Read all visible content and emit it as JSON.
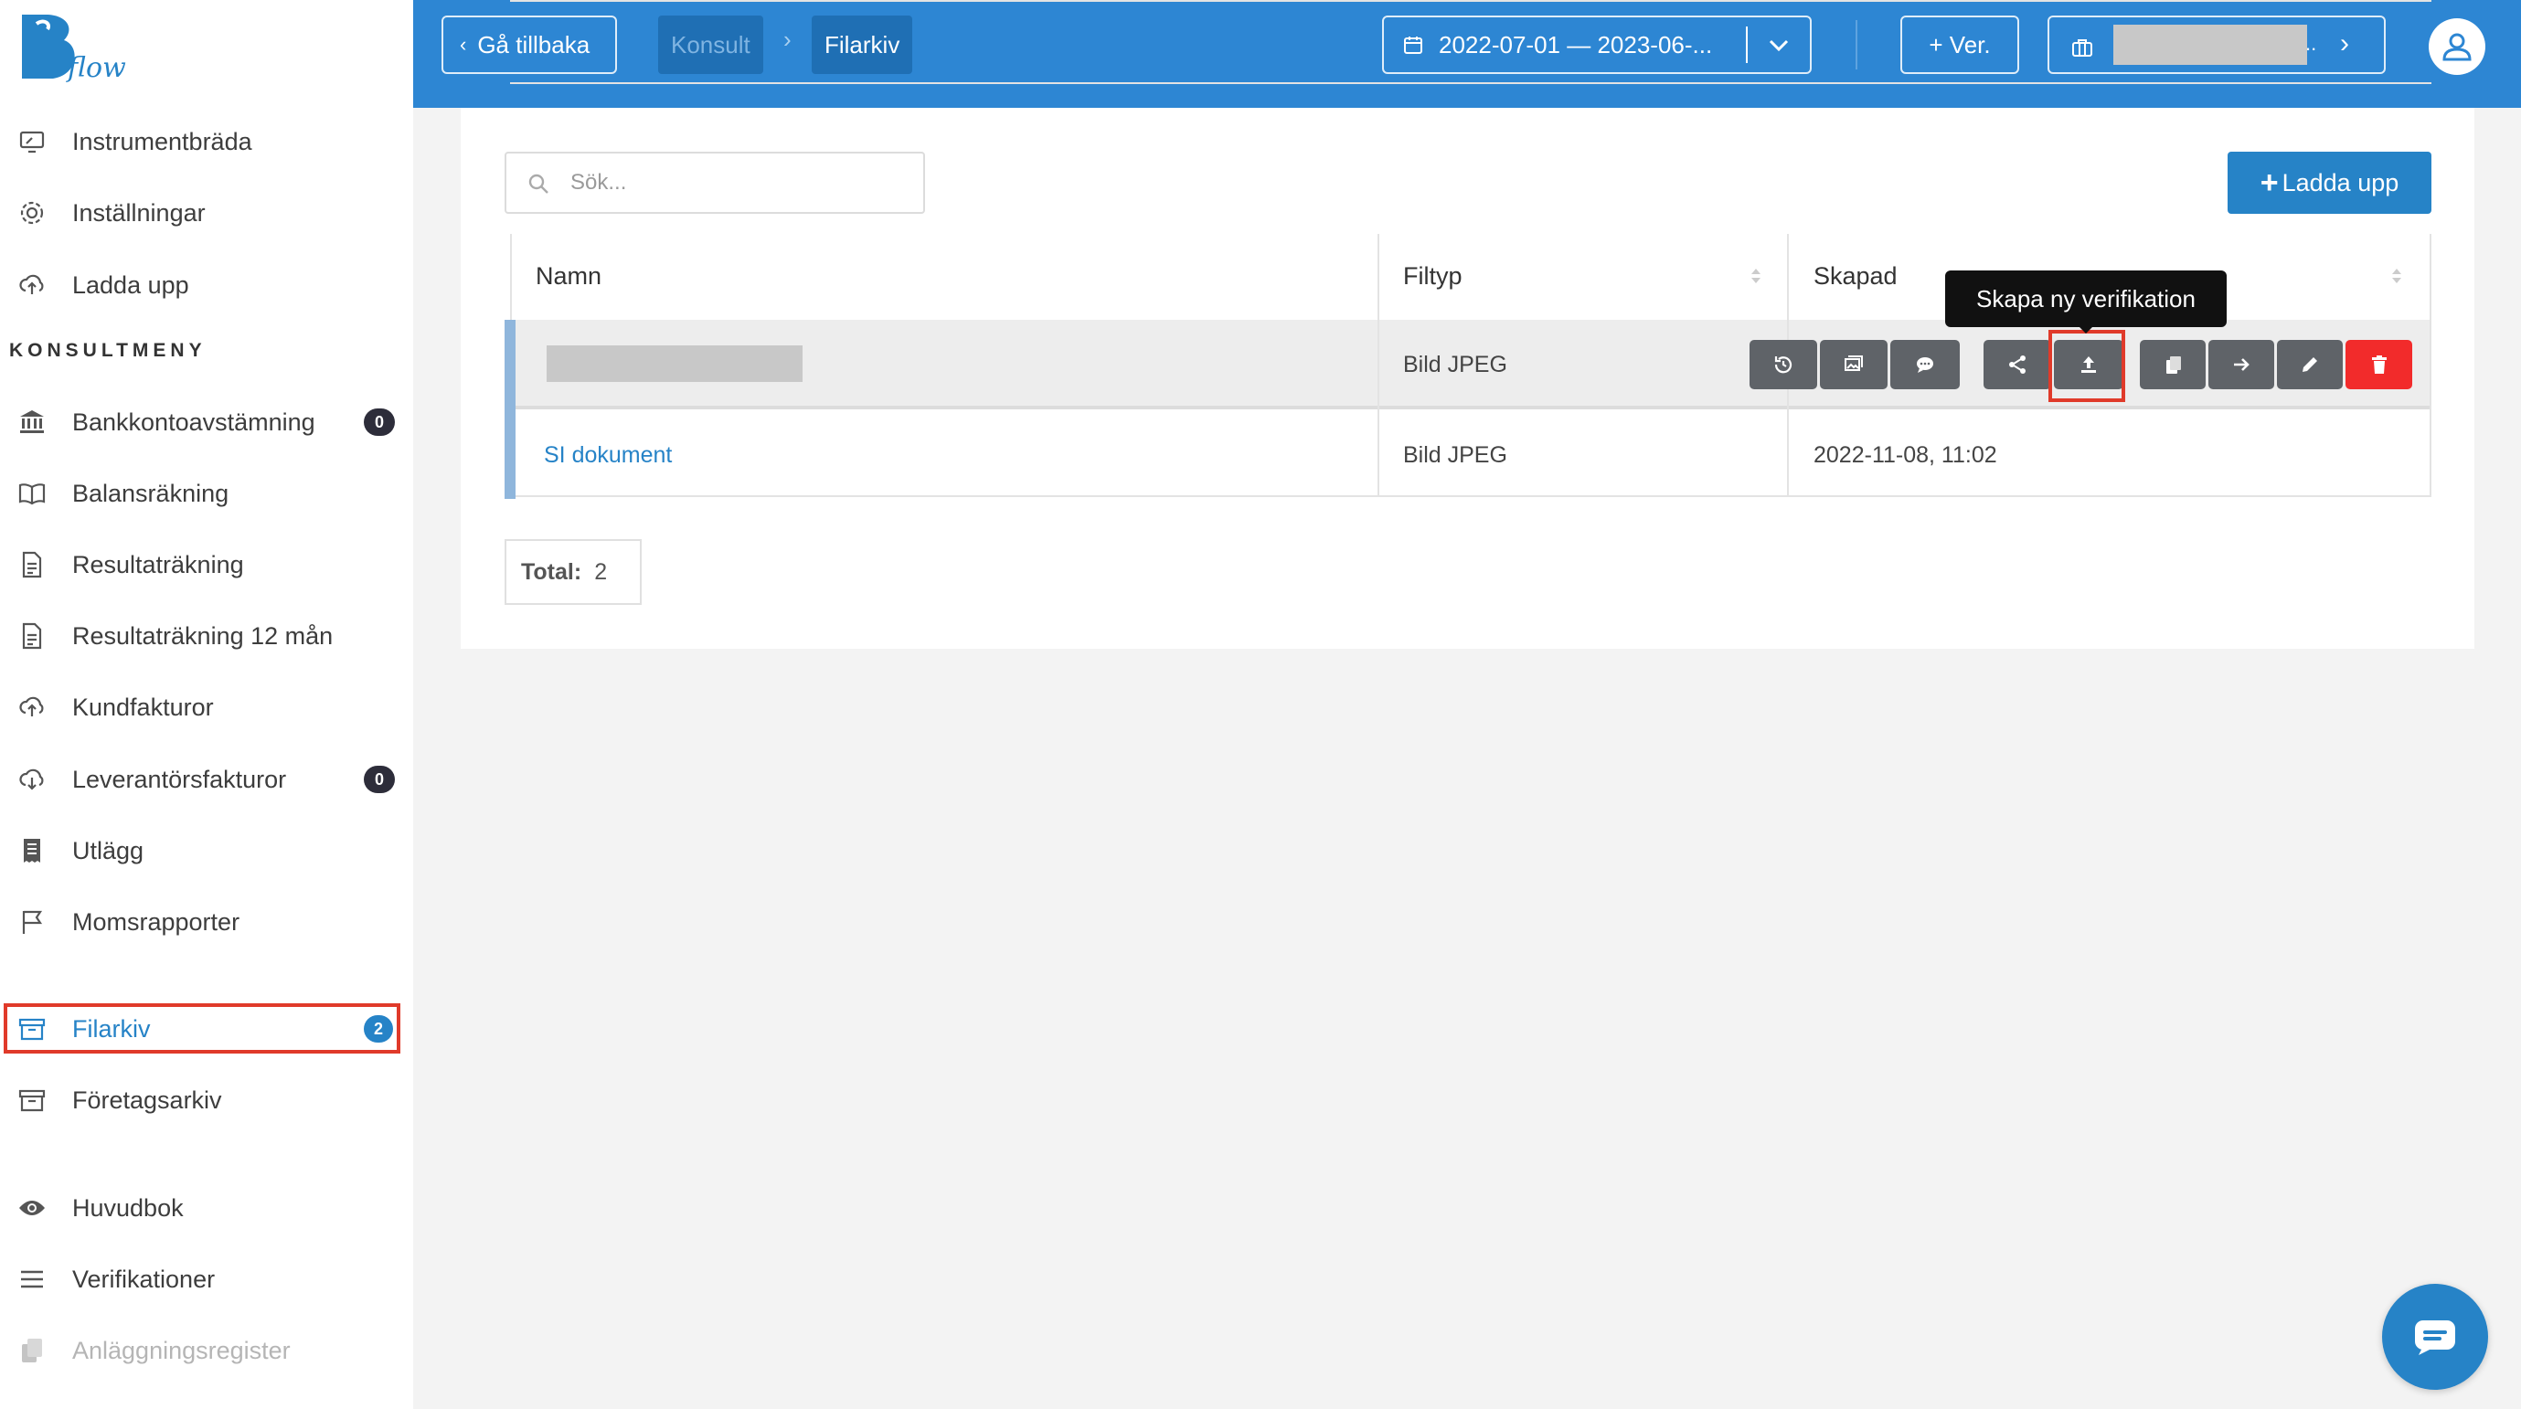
{
  "brand": {
    "logo_text": "flow",
    "accent": "#2683c7",
    "topbar_color": "#2d86d3"
  },
  "sidebar": {
    "items_top": [
      {
        "label": "Instrumentbräda",
        "icon": "monitor-icon"
      },
      {
        "label": "Inställningar",
        "icon": "gear-icon"
      },
      {
        "label": "Ladda upp",
        "icon": "cloud-upload-icon"
      }
    ],
    "section_title": "KONSULTMENY",
    "items_consult": [
      {
        "label": "Bankkontoavstämning",
        "icon": "bank-icon",
        "badge": "0"
      },
      {
        "label": "Balansräkning",
        "icon": "book-icon"
      },
      {
        "label": "Resultaträkning",
        "icon": "document-icon"
      },
      {
        "label": "Resultaträkning 12 mån",
        "icon": "document-icon"
      },
      {
        "label": "Kundfakturor",
        "icon": "cloud-upload-icon"
      },
      {
        "label": "Leverantörsfakturor",
        "icon": "cloud-download-icon",
        "badge": "0"
      },
      {
        "label": "Utlägg",
        "icon": "receipt-icon"
      },
      {
        "label": "Momsrapporter",
        "icon": "flag-icon"
      }
    ],
    "filarkiv": {
      "label": "Filarkiv",
      "icon": "archive-icon",
      "badge": "2"
    },
    "foretagsarkiv": {
      "label": "Företagsarkiv",
      "icon": "archive-icon"
    },
    "huvudbok": {
      "label": "Huvudbok",
      "icon": "eye-icon"
    },
    "verifikationer": {
      "label": "Verifikationer",
      "icon": "menu-lines-icon"
    },
    "anlaggning": {
      "label": "Anläggningsregister",
      "icon": "copy-icon"
    }
  },
  "topbar": {
    "back_label": "Gå tillbaka",
    "crumb_parent": "Konsult",
    "crumb_current": "Filarkiv",
    "date_range": "2022-07-01 — 2023-06-...",
    "new_ver_label": "+ Ver.",
    "company_suffix": ".."
  },
  "main": {
    "search_placeholder": "Sök...",
    "upload_label": "Ladda upp",
    "columns": [
      "Namn",
      "Filtyp",
      "Skapad"
    ],
    "rows": [
      {
        "name": "",
        "type": "Bild JPEG",
        "created": ""
      },
      {
        "name": "SI dokument",
        "type": "Bild JPEG",
        "created": "2022-11-08, 11:02"
      }
    ],
    "tooltip": "Skapa ny verifikation",
    "total_label": "Total:",
    "total_value": "2"
  }
}
